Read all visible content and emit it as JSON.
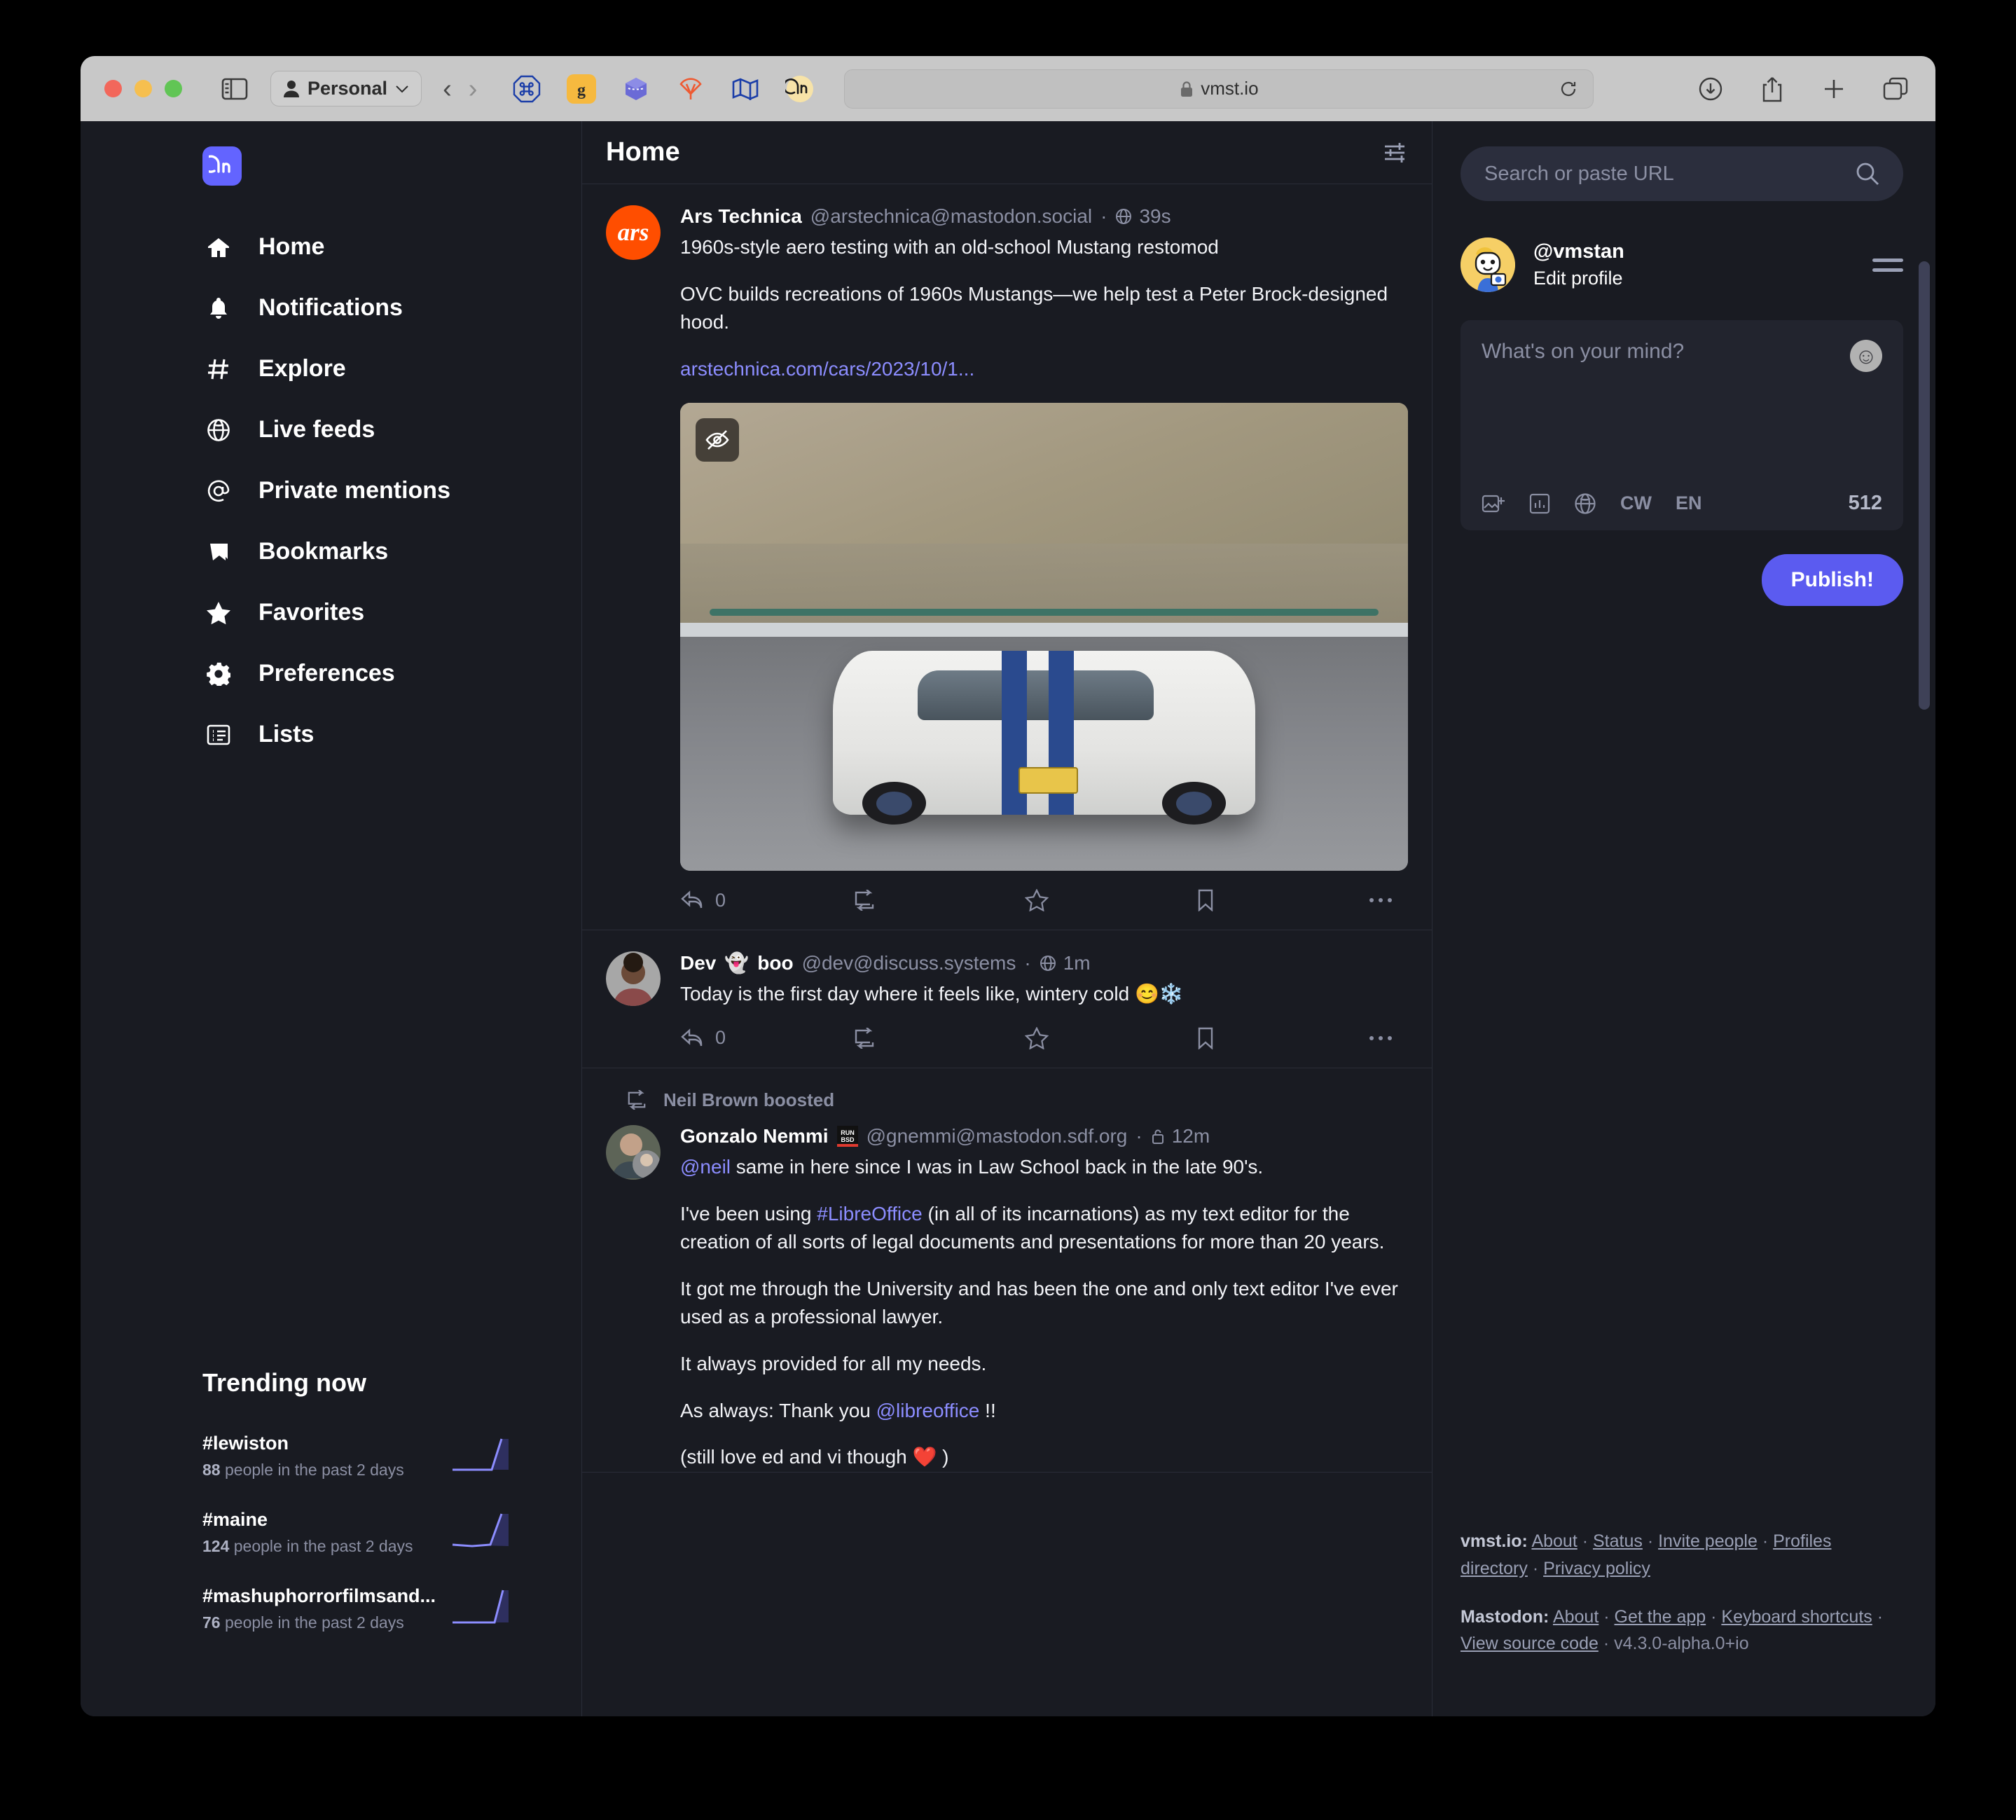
{
  "browser": {
    "profile_label": "Personal",
    "url": "vmst.io",
    "extensions": [
      "command-octagon-icon",
      "ghostery-icon",
      "cube-icon",
      "wiper-icon",
      "map-icon",
      "mastodon-icon"
    ],
    "right_actions": [
      "downloads-icon",
      "share-icon",
      "new-tab-icon",
      "tab-overview-icon"
    ]
  },
  "sidebar": {
    "logo": "mastodon-logo",
    "items": [
      {
        "label": "Home",
        "icon": "home-icon",
        "active": true
      },
      {
        "label": "Notifications",
        "icon": "bell-icon",
        "active": false
      },
      {
        "label": "Explore",
        "icon": "hashtag-icon",
        "active": false
      },
      {
        "label": "Live feeds",
        "icon": "globe-icon",
        "active": false
      },
      {
        "label": "Private mentions",
        "icon": "at-icon",
        "active": false
      },
      {
        "label": "Bookmarks",
        "icon": "bookmark-icon",
        "active": false
      },
      {
        "label": "Favorites",
        "icon": "star-icon",
        "active": false
      },
      {
        "label": "Preferences",
        "icon": "gear-icon",
        "active": false
      },
      {
        "label": "Lists",
        "icon": "list-icon",
        "active": false
      }
    ],
    "trending": {
      "title": "Trending now",
      "items": [
        {
          "tag": "#lewiston",
          "count": "88",
          "desc": "people in the past 2 days"
        },
        {
          "tag": "#maine",
          "count": "124",
          "desc": "people in the past 2 days"
        },
        {
          "tag": "#mashuphorrorfilmsand...",
          "count": "76",
          "desc": "people in the past 2 days"
        }
      ]
    }
  },
  "column": {
    "title": "Home",
    "settings_icon": "sliders-icon"
  },
  "posts": [
    {
      "avatar_text": "ars",
      "display_name": "Ars Technica",
      "handle": "@arstechnica@mastodon.social",
      "visibility_icon": "globe-icon",
      "timestamp": "39s",
      "title_line": "1960s-style aero testing with an old-school Mustang restomod",
      "body": "OVC builds recreations of 1960s Mustangs—we help test a Peter Brock-designed hood.",
      "link": "arstechnica.com/cars/2023/10/1...",
      "media_alt": "white Shelby Mustang with blue stripes on a racetrack",
      "media_hide_icon": "eye-off-icon",
      "actions": {
        "reply_count": "0",
        "boost_icon": "boost-icon",
        "favorite_icon": "star-icon",
        "bookmark_icon": "bookmark-icon",
        "more_icon": "ellipsis-icon"
      }
    },
    {
      "display_name": "Dev",
      "name_emoji": "👻",
      "display_name_2": "boo",
      "handle": "@dev@discuss.systems",
      "visibility_icon": "globe-icon",
      "timestamp": "1m",
      "body": "Today is the first day where it feels like, wintery cold",
      "body_emoji": "😊❄️",
      "actions": {
        "reply_count": "0",
        "boost_icon": "boost-icon",
        "favorite_icon": "star-icon",
        "bookmark_icon": "bookmark-icon",
        "more_icon": "ellipsis-icon"
      }
    },
    {
      "boosted_by": "Neil Brown boosted",
      "boost_icon": "boost-icon",
      "display_name": "Gonzalo Nemmi",
      "name_badge": "RUN BSD",
      "handle": "@gnemmi@mastodon.sdf.org",
      "visibility_icon": "unlisted-lock-icon",
      "timestamp": "12m",
      "paragraphs": [
        {
          "mention": "@neil",
          "rest": " same in here since I was in Law School back in the late 90's."
        },
        {
          "pre": "I've been using ",
          "hashtag": "#LibreOffice",
          "rest": " (in all of its incarnations) as my text editor for the creation of all sorts of legal documents and presentations for more than 20 years."
        },
        {
          "rest": "It got me through the University and has been the one and only text editor I've ever used as a professional lawyer."
        },
        {
          "rest": "It always provided for all my needs."
        },
        {
          "pre": "As always: Thank you ",
          "mention": "@libreoffice",
          "rest": " !!"
        },
        {
          "rest": "(still love ed and vi though ❤️ )"
        }
      ]
    }
  ],
  "compose_panel": {
    "search_placeholder": "Search or paste URL",
    "search_icon": "search-icon",
    "account_name": "@vmstan",
    "edit_profile": "Edit profile",
    "menu_icon": "hamburger-icon",
    "compose_placeholder": "What's on your mind?",
    "emoji_icon": "smiley-icon",
    "tools": [
      "image-icon",
      "poll-icon",
      "globe-icon"
    ],
    "cw_label": "CW",
    "lang_label": "EN",
    "char_count": "512",
    "publish_label": "Publish!",
    "accent_color": "#5b5bf0"
  },
  "footer": {
    "instance_label": "vmst.io:",
    "instance_links": [
      "About",
      "Status",
      "Invite people",
      "Profiles directory",
      "Privacy policy"
    ],
    "mastodon_label": "Mastodon:",
    "mastodon_links": [
      "About",
      "Get the app",
      "Keyboard shortcuts",
      "View source code"
    ],
    "version": "· v4.3.0-alpha.0+io"
  }
}
